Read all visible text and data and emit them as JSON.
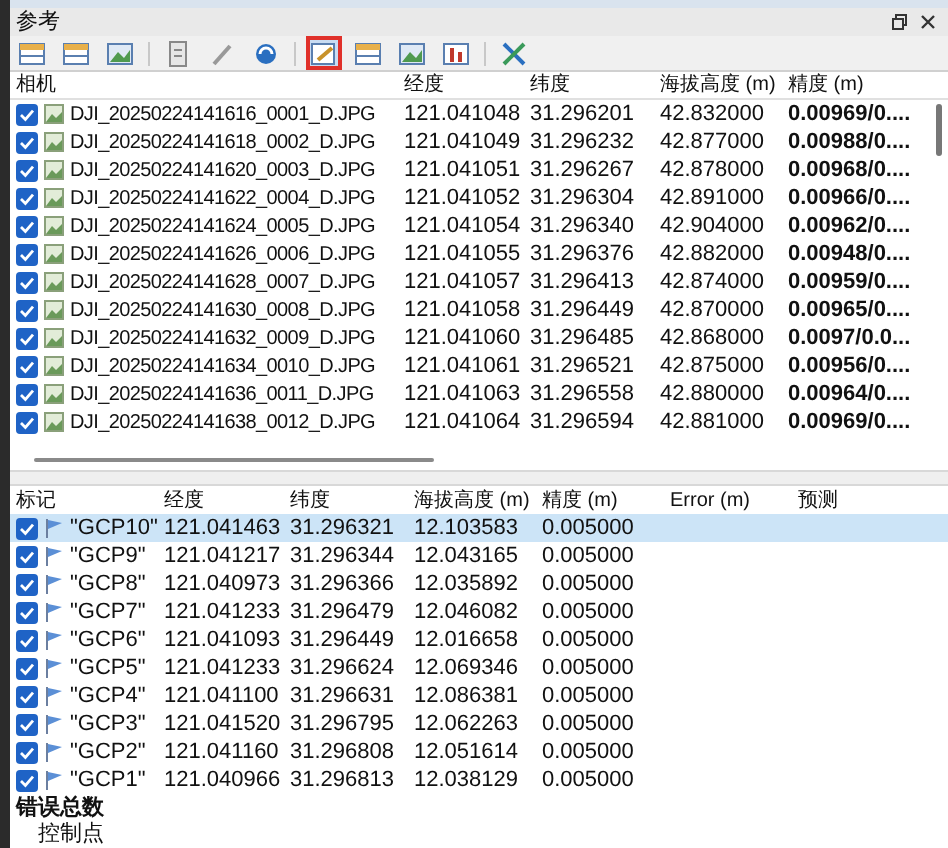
{
  "panel": {
    "title": "参考"
  },
  "toolbar": [
    {
      "kind": "sheet",
      "selected": false
    },
    {
      "kind": "sheet",
      "selected": false
    },
    {
      "kind": "photo",
      "selected": false
    },
    {
      "kind": "separator"
    },
    {
      "kind": "page",
      "selected": false
    },
    {
      "kind": "wand",
      "selected": false
    },
    {
      "kind": "refresh",
      "selected": false
    },
    {
      "kind": "separator"
    },
    {
      "kind": "edit",
      "selected": true
    },
    {
      "kind": "sheet",
      "selected": false
    },
    {
      "kind": "photo",
      "selected": false
    },
    {
      "kind": "bars",
      "selected": false
    },
    {
      "kind": "separator"
    },
    {
      "kind": "tools",
      "selected": false
    }
  ],
  "cameras": {
    "columns": [
      "相机",
      "经度",
      "纬度",
      "海拔高度 (m)",
      "精度 (m)"
    ],
    "rows": [
      {
        "checked": true,
        "name": "DJI_20250224141616_0001_D.JPG",
        "lon": "121.041048",
        "lat": "31.296201",
        "alt": "42.832000",
        "acc": "0.00969/0...."
      },
      {
        "checked": true,
        "name": "DJI_20250224141618_0002_D.JPG",
        "lon": "121.041049",
        "lat": "31.296232",
        "alt": "42.877000",
        "acc": "0.00988/0...."
      },
      {
        "checked": true,
        "name": "DJI_20250224141620_0003_D.JPG",
        "lon": "121.041051",
        "lat": "31.296267",
        "alt": "42.878000",
        "acc": "0.00968/0...."
      },
      {
        "checked": true,
        "name": "DJI_20250224141622_0004_D.JPG",
        "lon": "121.041052",
        "lat": "31.296304",
        "alt": "42.891000",
        "acc": "0.00966/0...."
      },
      {
        "checked": true,
        "name": "DJI_20250224141624_0005_D.JPG",
        "lon": "121.041054",
        "lat": "31.296340",
        "alt": "42.904000",
        "acc": "0.00962/0...."
      },
      {
        "checked": true,
        "name": "DJI_20250224141626_0006_D.JPG",
        "lon": "121.041055",
        "lat": "31.296376",
        "alt": "42.882000",
        "acc": "0.00948/0...."
      },
      {
        "checked": true,
        "name": "DJI_20250224141628_0007_D.JPG",
        "lon": "121.041057",
        "lat": "31.296413",
        "alt": "42.874000",
        "acc": "0.00959/0...."
      },
      {
        "checked": true,
        "name": "DJI_20250224141630_0008_D.JPG",
        "lon": "121.041058",
        "lat": "31.296449",
        "alt": "42.870000",
        "acc": "0.00965/0...."
      },
      {
        "checked": true,
        "name": "DJI_20250224141632_0009_D.JPG",
        "lon": "121.041060",
        "lat": "31.296485",
        "alt": "42.868000",
        "acc": "0.0097/0.0..."
      },
      {
        "checked": true,
        "name": "DJI_20250224141634_0010_D.JPG",
        "lon": "121.041061",
        "lat": "31.296521",
        "alt": "42.875000",
        "acc": "0.00956/0...."
      },
      {
        "checked": true,
        "name": "DJI_20250224141636_0011_D.JPG",
        "lon": "121.041063",
        "lat": "31.296558",
        "alt": "42.880000",
        "acc": "0.00964/0...."
      },
      {
        "checked": true,
        "name": "DJI_20250224141638_0012_D.JPG",
        "lon": "121.041064",
        "lat": "31.296594",
        "alt": "42.881000",
        "acc": "0.00969/0...."
      }
    ]
  },
  "markers": {
    "columns": [
      "标记",
      "经度",
      "纬度",
      "海拔高度 (m)",
      "精度 (m)",
      "Error (m)",
      "预测"
    ],
    "rows": [
      {
        "checked": true,
        "selected": true,
        "label": "\"GCP10\"",
        "lon": "121.041463",
        "lat": "31.296321",
        "alt": "12.103583",
        "acc": "0.005000"
      },
      {
        "checked": true,
        "selected": false,
        "label": "\"GCP9\"",
        "lon": "121.041217",
        "lat": "31.296344",
        "alt": "12.043165",
        "acc": "0.005000"
      },
      {
        "checked": true,
        "selected": false,
        "label": "\"GCP8\"",
        "lon": "121.040973",
        "lat": "31.296366",
        "alt": "12.035892",
        "acc": "0.005000"
      },
      {
        "checked": true,
        "selected": false,
        "label": "\"GCP7\"",
        "lon": "121.041233",
        "lat": "31.296479",
        "alt": "12.046082",
        "acc": "0.005000"
      },
      {
        "checked": true,
        "selected": false,
        "label": "\"GCP6\"",
        "lon": "121.041093",
        "lat": "31.296449",
        "alt": "12.016658",
        "acc": "0.005000"
      },
      {
        "checked": true,
        "selected": false,
        "label": "\"GCP5\"",
        "lon": "121.041233",
        "lat": "31.296624",
        "alt": "12.069346",
        "acc": "0.005000"
      },
      {
        "checked": true,
        "selected": false,
        "label": "\"GCP4\"",
        "lon": "121.041100",
        "lat": "31.296631",
        "alt": "12.086381",
        "acc": "0.005000"
      },
      {
        "checked": true,
        "selected": false,
        "label": "\"GCP3\"",
        "lon": "121.041520",
        "lat": "31.296795",
        "alt": "12.062263",
        "acc": "0.005000"
      },
      {
        "checked": true,
        "selected": false,
        "label": "\"GCP2\"",
        "lon": "121.041160",
        "lat": "31.296808",
        "alt": "12.051614",
        "acc": "0.005000"
      },
      {
        "checked": true,
        "selected": false,
        "label": "\"GCP1\"",
        "lon": "121.040966",
        "lat": "31.296813",
        "alt": "12.038129",
        "acc": "0.005000"
      }
    ]
  },
  "summary": {
    "heading": "错误总数",
    "item": "控制点"
  }
}
